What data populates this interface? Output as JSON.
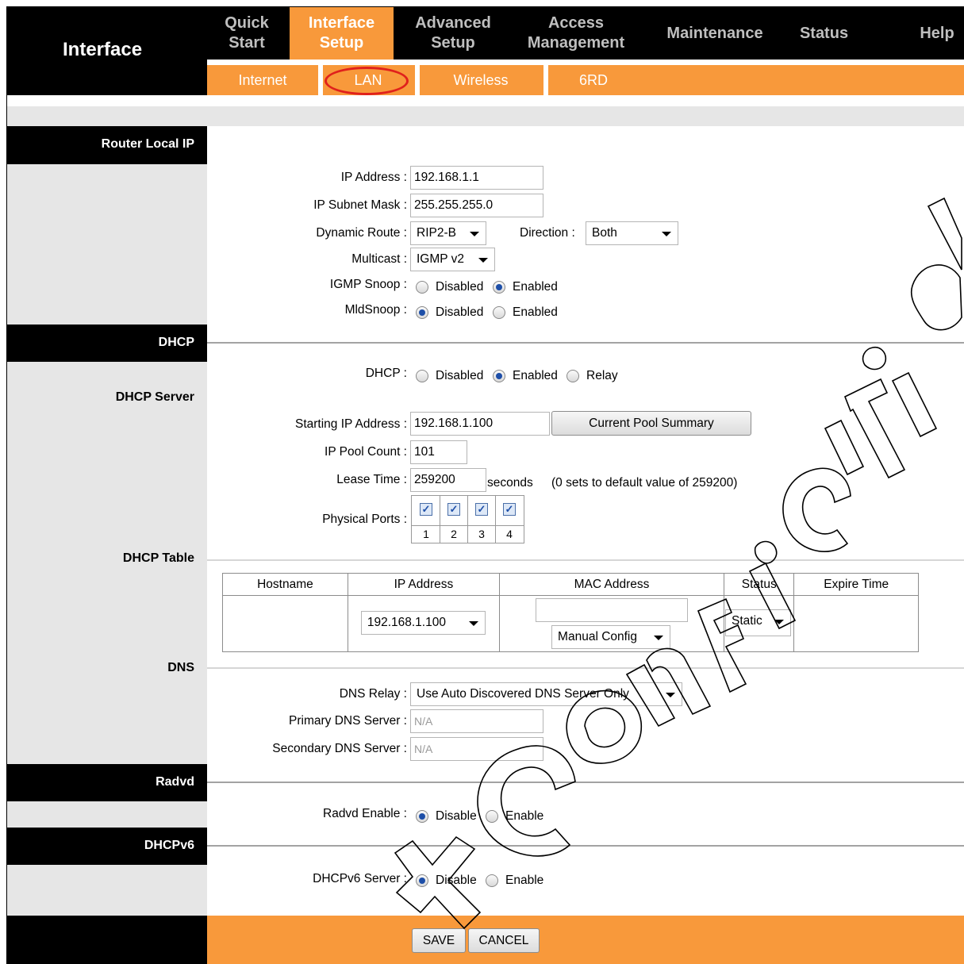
{
  "header": {
    "brand": "Interface",
    "tabs": [
      {
        "line1": "Quick",
        "line2": "Start"
      },
      {
        "line1": "Interface",
        "line2": "Setup"
      },
      {
        "line1": "Advanced",
        "line2": "Setup"
      },
      {
        "line1": "Access",
        "line2": "Management"
      },
      {
        "line1": "Maintenance",
        "line2": ""
      },
      {
        "line1": "Status",
        "line2": ""
      },
      {
        "line1": "Help",
        "line2": ""
      }
    ],
    "subtabs": [
      "Internet",
      "LAN",
      "Wireless",
      "6RD"
    ]
  },
  "sections": {
    "router_local_ip": "Router Local IP",
    "dhcp": "DHCP",
    "dhcp_server": "DHCP Server",
    "dhcp_table": "DHCP Table",
    "dns": "DNS",
    "radvd": "Radvd",
    "dhcpv6": "DHCPv6"
  },
  "router": {
    "ip_label": "IP Address :",
    "ip_value": "192.168.1.1",
    "mask_label": "IP Subnet Mask :",
    "mask_value": "255.255.255.0",
    "dynroute_label": "Dynamic Route :",
    "dynroute_value": "RIP2-B",
    "direction_label": "Direction :",
    "direction_value": "Both",
    "multicast_label": "Multicast :",
    "multicast_value": "IGMP v2",
    "igmp_label": "IGMP Snoop :",
    "mld_label": "MldSnoop :",
    "disabled": "Disabled",
    "enabled": "Enabled"
  },
  "dhcp": {
    "dhcp_label": "DHCP :",
    "disabled": "Disabled",
    "enabled": "Enabled",
    "relay": "Relay",
    "start_label": "Starting IP Address :",
    "start_value": "192.168.1.100",
    "pool_button": "Current Pool Summary",
    "count_label": "IP Pool Count :",
    "count_value": "101",
    "lease_label": "Lease Time :",
    "lease_value": "259200",
    "lease_unit": "seconds",
    "lease_note": "(0 sets to default value of 259200)",
    "ports_label": "Physical Ports :",
    "ports": [
      "1",
      "2",
      "3",
      "4"
    ],
    "ports_checked": [
      true,
      true,
      true,
      true
    ]
  },
  "dhcp_table": {
    "headers": [
      "Hostname",
      "IP Address",
      "MAC Address",
      "Status",
      "Expire Time"
    ],
    "ip_select": "192.168.1.100",
    "mac_value": "",
    "mac_select": "Manual Config",
    "status_select": "Static"
  },
  "dns": {
    "relay_label": "DNS Relay :",
    "relay_value": "Use Auto Discovered DNS Server Only",
    "primary_label": "Primary DNS Server :",
    "primary_value": "N/A",
    "secondary_label": "Secondary DNS Server :",
    "secondary_value": "N/A"
  },
  "radvd": {
    "label": "Radvd Enable :",
    "disable": "Disable",
    "enable": "Enable"
  },
  "dhcpv6": {
    "label": "DHCPv6 Server :",
    "disable": "Disable",
    "enable": "Enable"
  },
  "footer": {
    "save": "SAVE",
    "cancel": "CANCEL"
  },
  "colors": {
    "accent_orange": "#f8993b",
    "header_black": "#000000",
    "panel_grey": "#e6e6e6",
    "highlight_red": "#e0211c"
  }
}
